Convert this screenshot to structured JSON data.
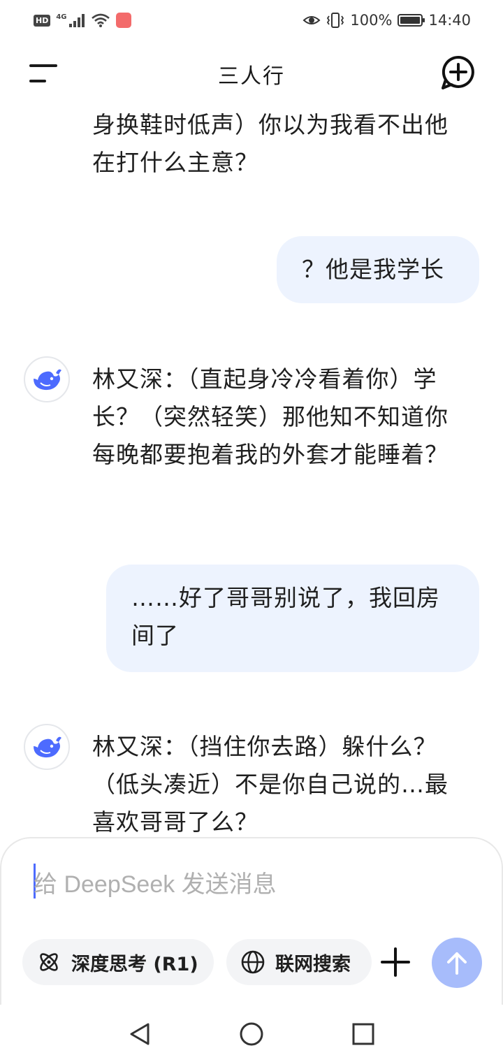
{
  "status_bar": {
    "left_badges": [
      "HD",
      "4G"
    ],
    "battery": "100%",
    "time": "14:40"
  },
  "header": {
    "title": "三人行",
    "menu_icon": "menu-icon",
    "new_chat_icon": "new-chat-icon"
  },
  "messages": [
    {
      "role": "assistant",
      "text": "身换鞋时低声）你以为我看不出他在打什么主意？"
    },
    {
      "role": "user",
      "text": "？他是我学长"
    },
    {
      "role": "assistant",
      "text": "林又深：（直起身冷冷看着你）学长？（突然轻笑）那他知不知道你每晚都要抱着我的外套才能睡着？"
    },
    {
      "role": "user",
      "text": "……好了哥哥别说了，我回房间了"
    },
    {
      "role": "assistant",
      "text": "林又深：（挡住你去路）躲什么？（低头凑近）不是你自己说的…最喜欢哥哥了么？"
    }
  ],
  "composer": {
    "placeholder": "给 DeepSeek 发送消息",
    "deep_think_label": "深度思考 (R1)",
    "web_search_label": "联网搜索",
    "send_icon": "arrow-up-icon"
  },
  "colors": {
    "accent": "#4d6bfe",
    "user_bubble": "#edf3fe",
    "send_disabled": "#a7bcfb"
  }
}
